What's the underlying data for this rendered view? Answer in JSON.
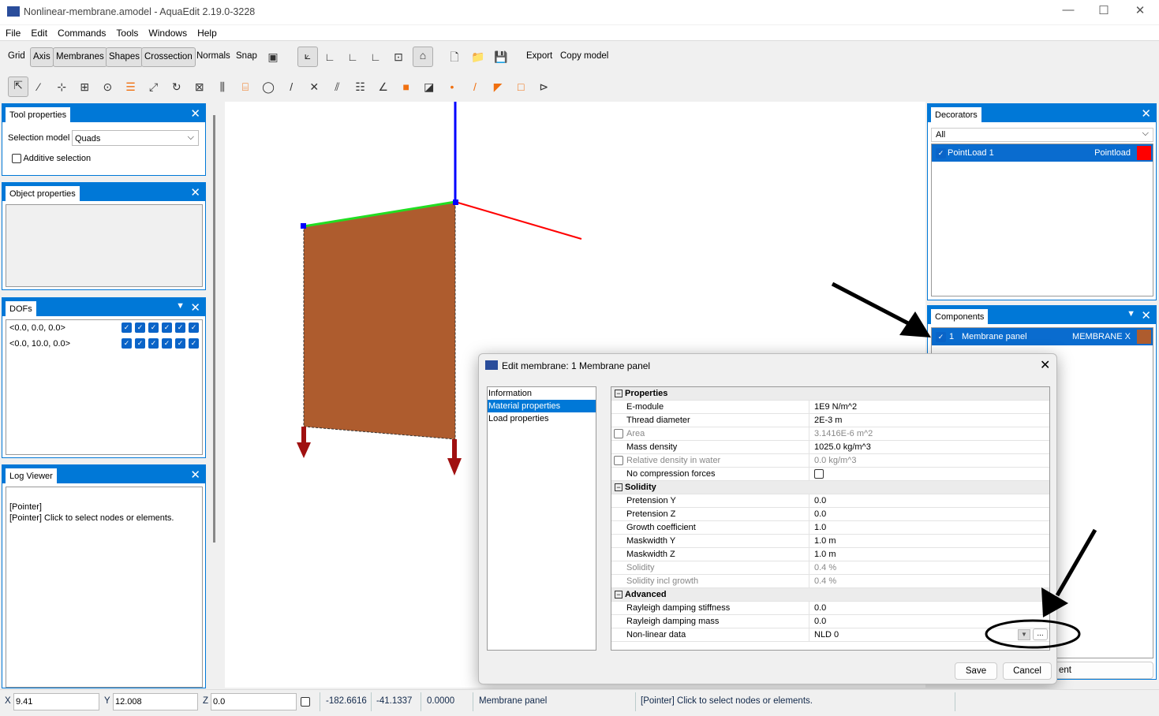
{
  "window": {
    "title": "Nonlinear-membrane.amodel - AquaEdit 2.19.0-3228",
    "minimize": "—",
    "maximize": "☐",
    "close": "✕"
  },
  "menu": [
    "File",
    "Edit",
    "Commands",
    "Tools",
    "Windows",
    "Help"
  ],
  "toolbar1": {
    "buttons": [
      {
        "label": "Grid",
        "on": false
      },
      {
        "label": "Axis",
        "on": true
      },
      {
        "label": "Membranes",
        "on": true
      },
      {
        "label": "Shapes",
        "on": true
      },
      {
        "label": "Crossection",
        "on": true
      },
      {
        "label": "Normals",
        "on": false
      },
      {
        "label": "Snap",
        "on": false
      }
    ],
    "export": "Export",
    "copy_model": "Copy model"
  },
  "toolbar2_icons": [
    "pointer-icon",
    "line-icon",
    "add-node-icon",
    "add-grid-node-icon",
    "circle-node-icon",
    "cylinder-icon",
    "move-icon",
    "rotate-icon",
    "fit-icon",
    "bars-icon",
    "cylinder-outline-icon",
    "ellipse-icon",
    "diagonal-icon",
    "cross-icon",
    "parallel-icon",
    "pipe-icon",
    "angle-icon",
    "square-add-icon",
    "diagonal-square-icon",
    "point-add-icon",
    "line-add-icon",
    "triangle-add-icon",
    "frame-add-icon",
    "link-icon"
  ],
  "tool_properties": {
    "title": "Tool properties",
    "selection_model_label": "Selection model",
    "selection_model_value": "Quads",
    "additive_selection": "Additive selection"
  },
  "object_properties": {
    "title": "Object properties"
  },
  "dofs": {
    "title": "DOFs",
    "rows": [
      "<0.0, 0.0, 0.0>",
      "<0.0, 10.0, 0.0>"
    ]
  },
  "log_viewer": {
    "title": "Log Viewer",
    "lines": [
      "[Pointer]",
      "[Pointer] Click to select nodes or elements."
    ]
  },
  "decorators": {
    "title": "Decorators",
    "filter": "All",
    "items": [
      {
        "name": "PointLoad 1",
        "type": "Pointload",
        "color": "#ff0000"
      }
    ]
  },
  "components": {
    "title": "Components",
    "items": [
      {
        "index": "1",
        "name": "Membrane panel",
        "type": "MEMBRANE X",
        "color": "#ae5c2e"
      }
    ],
    "hidden_button": "ent"
  },
  "dialog": {
    "title": "Edit membrane: 1 Membrane panel",
    "nav": [
      {
        "label": "Information",
        "selected": false
      },
      {
        "label": "Material properties",
        "selected": true
      },
      {
        "label": "Load properties",
        "selected": false
      }
    ],
    "groups": [
      {
        "name": "Properties",
        "rows": [
          {
            "k": "E-module",
            "v": "1E9 N/m^2"
          },
          {
            "k": "Thread diameter",
            "v": "2E-3 m"
          },
          {
            "k": "Area",
            "v": "3.1416E-6 m^2",
            "disabled": true,
            "check": true
          },
          {
            "k": "Mass density",
            "v": "1025.0 kg/m^3"
          },
          {
            "k": "Relative density in water",
            "v": "0.0 kg/m^3",
            "disabled": true,
            "check": true
          },
          {
            "k": "No compression forces",
            "v": "",
            "valcheck": true
          }
        ]
      },
      {
        "name": "Solidity",
        "rows": [
          {
            "k": "Pretension Y",
            "v": "0.0"
          },
          {
            "k": "Pretension Z",
            "v": "0.0"
          },
          {
            "k": "Growth coefficient",
            "v": "1.0"
          },
          {
            "k": "Maskwidth Y",
            "v": "1.0 m"
          },
          {
            "k": "Maskwidth Z",
            "v": "1.0 m"
          },
          {
            "k": "Solidity",
            "v": "0.4 %",
            "disabled": true
          },
          {
            "k": "Solidity incl growth",
            "v": "0.4 %",
            "disabled": true
          }
        ]
      },
      {
        "name": "Advanced",
        "rows": [
          {
            "k": "Rayleigh damping stiffness",
            "v": "0.0"
          },
          {
            "k": "Rayleigh damping mass",
            "v": "0.0"
          },
          {
            "k": "Non-linear data",
            "v": "NLD 0",
            "dropdown": true
          }
        ]
      }
    ],
    "ellipsis": "...",
    "save": "Save",
    "cancel": "Cancel"
  },
  "status": {
    "x_label": "X",
    "x": "9.41",
    "y_label": "Y",
    "y": "12.008",
    "z_label": "Z",
    "z": "0.0",
    "v1": "-182.6616",
    "v2": "-41.1337",
    "v3": "0.0000",
    "selection": "Membrane panel",
    "message": "[Pointer] Click to select nodes or elements."
  },
  "colors": {
    "accent": "#0078d7",
    "membrane": "#ae5c2e",
    "load": "#ff0000"
  }
}
